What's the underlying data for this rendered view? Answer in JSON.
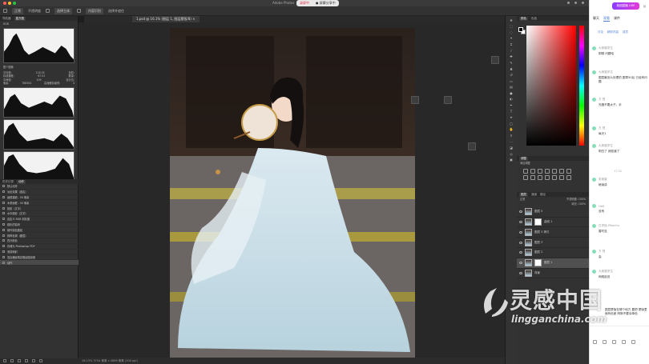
{
  "app": {
    "title": "Adobe Photos"
  },
  "recording": {
    "stop_label": "录屏中",
    "share_label": "● 屏幕分享中"
  },
  "options_bar": {
    "mode": "正常",
    "opacity": "不透明度",
    "select_subject": "选择主体",
    "refine": "选择并遮住",
    "fill": "内容识别"
  },
  "document_tab": {
    "label": "1.psd @ 16.1% (图层 1, 图层蒙版/8) ×"
  },
  "left_panel": {
    "tabs": [
      "导航器",
      "直方图"
    ],
    "active_tab": "直方图",
    "channel": "RGB",
    "source": "整个图像",
    "stats": [
      [
        "平均值:",
        "118.55",
        "色阶:",
        ""
      ],
      [
        "标准偏差:",
        "67.02",
        "数量:",
        ""
      ],
      [
        "中间值:",
        "109",
        "百分位:",
        ""
      ],
      [
        "像素:",
        "786304",
        "高速缓存级别:",
        "4"
      ]
    ]
  },
  "history": {
    "tabs": [
      "历史记录",
      "动作"
    ],
    "items": [
      "默认动作",
      "淡出效果（选区）",
      "画框通道 - 50 像素",
      "木质画框 - 50 像素",
      "投影（文字）",
      "水中倒影（文字）",
      "自定义 RGB 到灰度",
      "熔化的铅块",
      "制作剪贴路径",
      "棕褐色调（图层）",
      "四分颜色",
      "存储为 Photoshop PDF",
      "渐变映射",
      "混合器画笔克隆绘图设置",
      "动作"
    ],
    "selected_index": 14
  },
  "status": {
    "text": "16.13%   3744 像素 x 4866 像素 (300 ppi)"
  },
  "right_panel": {
    "color_tabs": [
      "颜色",
      "色板"
    ],
    "adjust_tabs": [
      "调整"
    ],
    "adjust_label": "添加调整",
    "layer_tabs": [
      "图层",
      "通道",
      "路径"
    ],
    "blend": "正常",
    "opacity_label": "不透明度: 100%",
    "fill_label": "填充: 100%",
    "layers": [
      {
        "name": "图层 5",
        "type": "pixel",
        "selected": false
      },
      {
        "name": "曲线 1",
        "type": "adjust",
        "selected": false
      },
      {
        "name": "图层 3 拷贝",
        "type": "pixel",
        "selected": false
      },
      {
        "name": "图层 3",
        "type": "pixel",
        "selected": false
      },
      {
        "name": "图层 2",
        "type": "pixel",
        "selected": false
      },
      {
        "name": "图层 1",
        "type": "mask",
        "selected": true
      },
      {
        "name": "背景",
        "type": "bg",
        "selected": false
      }
    ]
  },
  "chat": {
    "banner": "新团直播 LIVE",
    "tabs1": [
      "聊天",
      "观看",
      "课件"
    ],
    "tabs2": [
      "讨论",
      "精彩内容",
      "成员"
    ],
    "time_divider": "17:32",
    "messages": [
      {
        "user": "大熊猫学生",
        "text": "刚刚 问题哈"
      },
      {
        "user": "大熊猫学生",
        "text": "图层最怎么处理的 图章50后 已经有问题"
      },
      {
        "user": "方 慧",
        "text": "光圈不要太子。手"
      },
      {
        "user": "方 慧",
        "text": "每天1"
      },
      {
        "user": "大熊猫学生",
        "text": "明白了 我知道了"
      },
      {
        "user": "张家豪",
        "text": "继续讲"
      },
      {
        "user": "Hd9",
        "text": "没有"
      },
      {
        "user": "白学徒-Pikachu",
        "text": "暂时没"
      },
      {
        "user": "方 慧",
        "text": "会"
      },
      {
        "user": "大熊猫学生",
        "text": "网络延迟"
      },
      {
        "user": "",
        "text": "图层蒙版在哪个地方 要把 蒙版里面有色差 阿斯不要涂单色"
      }
    ]
  },
  "watermark": {
    "cn": "灵感中国",
    "en": "lingganchina.com"
  },
  "colors": {
    "accent": "#4a7bd8",
    "stop": "#e0304a",
    "banner_start": "#8b3cff",
    "banner_end": "#e33bd8"
  }
}
